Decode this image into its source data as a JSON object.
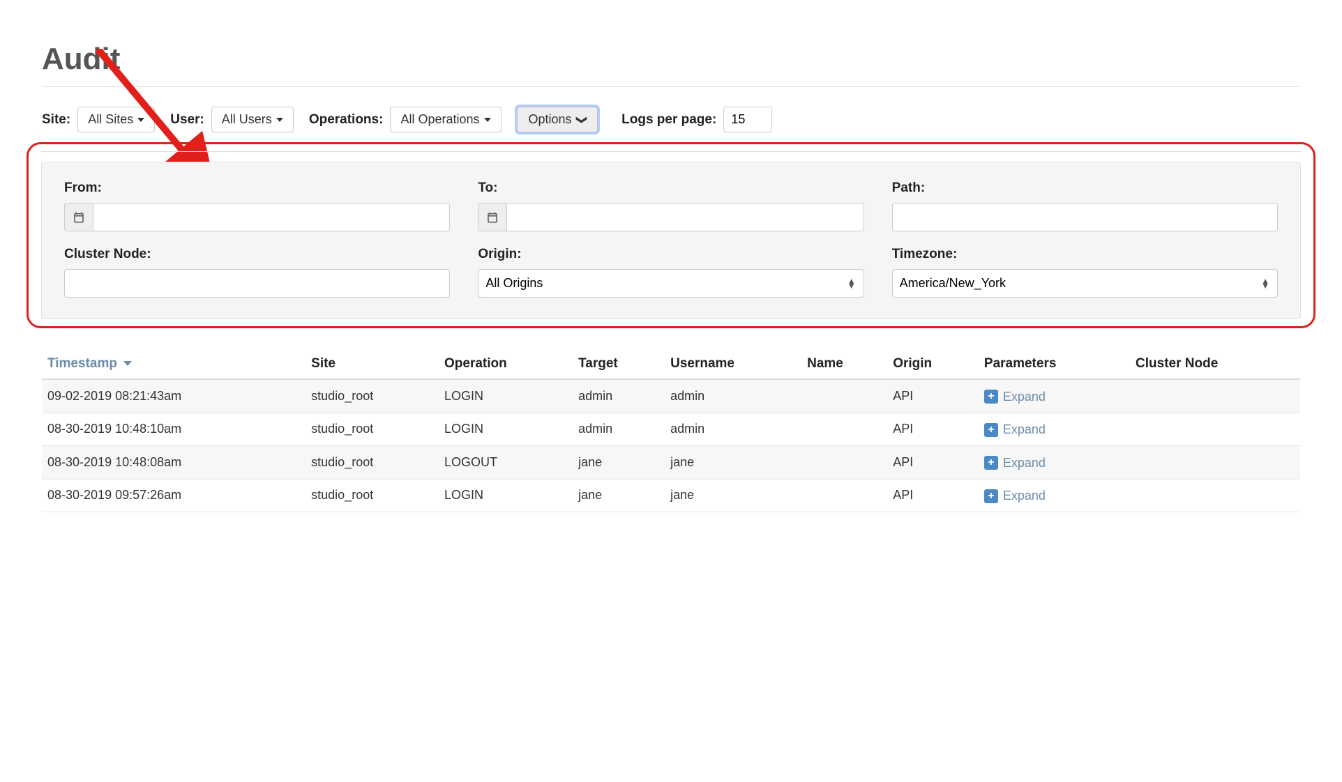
{
  "page": {
    "title": "Audit"
  },
  "filters": {
    "site_label": "Site:",
    "site_value": "All Sites",
    "user_label": "User:",
    "user_value": "All Users",
    "operations_label": "Operations:",
    "operations_value": "All Operations",
    "options_label": "Options",
    "logs_per_page_label": "Logs per page:",
    "logs_per_page_value": "15"
  },
  "options_panel": {
    "from_label": "From:",
    "from_value": "",
    "to_label": "To:",
    "to_value": "",
    "path_label": "Path:",
    "path_value": "",
    "cluster_node_label": "Cluster Node:",
    "cluster_node_value": "",
    "origin_label": "Origin:",
    "origin_value": "All Origins",
    "timezone_label": "Timezone:",
    "timezone_value": "America/New_York"
  },
  "table": {
    "headers": {
      "timestamp": "Timestamp",
      "site": "Site",
      "operation": "Operation",
      "target": "Target",
      "username": "Username",
      "name": "Name",
      "origin": "Origin",
      "parameters": "Parameters",
      "cluster_node": "Cluster Node"
    },
    "expand_label": "Expand",
    "rows": [
      {
        "timestamp": "09-02-2019 08:21:43am",
        "site": "studio_root",
        "operation": "LOGIN",
        "target": "admin",
        "username": "admin",
        "name": "",
        "origin": "API",
        "cluster_node": ""
      },
      {
        "timestamp": "08-30-2019 10:48:10am",
        "site": "studio_root",
        "operation": "LOGIN",
        "target": "admin",
        "username": "admin",
        "name": "",
        "origin": "API",
        "cluster_node": ""
      },
      {
        "timestamp": "08-30-2019 10:48:08am",
        "site": "studio_root",
        "operation": "LOGOUT",
        "target": "jane",
        "username": "jane",
        "name": "",
        "origin": "API",
        "cluster_node": ""
      },
      {
        "timestamp": "08-30-2019 09:57:26am",
        "site": "studio_root",
        "operation": "LOGIN",
        "target": "jane",
        "username": "jane",
        "name": "",
        "origin": "API",
        "cluster_node": ""
      }
    ]
  }
}
